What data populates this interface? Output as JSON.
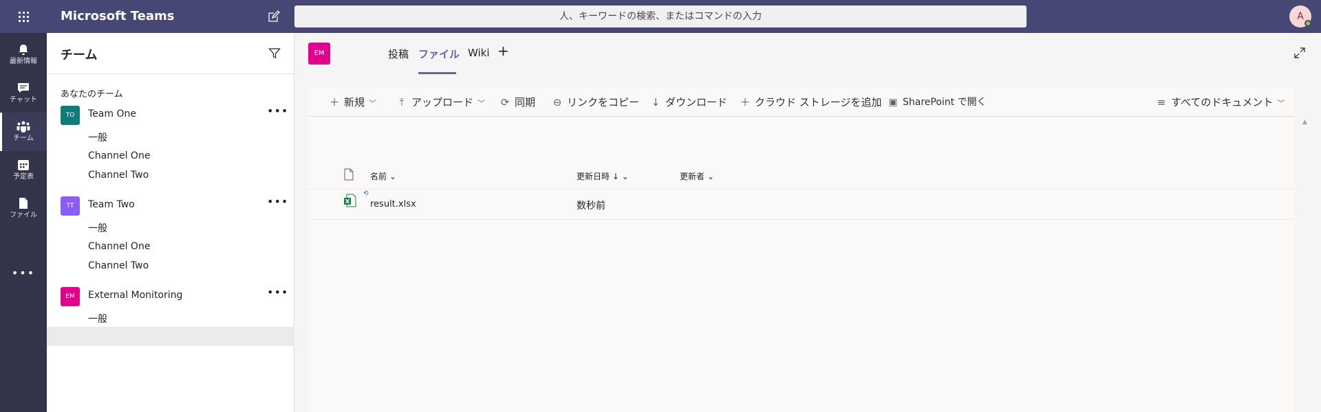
{
  "app": {
    "title": "Microsoft Teams",
    "search_placeholder": "人、キーワードの検索、またはコマンドの入力",
    "user_initial": "A",
    "accent": "#464775"
  },
  "rail": [
    {
      "label": "最新情報",
      "icon": "bell-icon",
      "active": false
    },
    {
      "label": "チャット",
      "icon": "chat-icon",
      "active": false
    },
    {
      "label": "チーム",
      "icon": "teams-icon",
      "active": true
    },
    {
      "label": "予定表",
      "icon": "calendar-icon",
      "active": false
    },
    {
      "label": "ファイル",
      "icon": "files-icon",
      "active": false
    }
  ],
  "rail_more": "•••",
  "teams_pane": {
    "title": "チーム",
    "section_label": "あなたのチーム",
    "teams": [
      {
        "initials": "TO",
        "name": "Team One",
        "color": "#0f7b7b",
        "channels": [
          "一般",
          "Channel One",
          "Channel Two"
        ]
      },
      {
        "initials": "TT",
        "name": "Team Two",
        "color": "#8b5cf6",
        "channels": [
          "一般",
          "Channel One",
          "Channel Two"
        ]
      },
      {
        "initials": "EM",
        "name": "External Monitoring",
        "color": "#e3008c",
        "channels": [
          "一般"
        ]
      }
    ],
    "more": "•••"
  },
  "main": {
    "team_initials": "EM",
    "tabs": [
      {
        "label": "投稿",
        "active": false
      },
      {
        "label": "ファイル",
        "active": true
      },
      {
        "label": "Wiki",
        "active": false
      }
    ],
    "tab_add": "+",
    "toolbar": {
      "new": "新規",
      "upload": "アップロード",
      "sync": "同期",
      "copy_link": "リンクをコピー",
      "download": "ダウンロード",
      "add_cloud": "クラウド ストレージを追加",
      "sharepoint": "SharePoint で開く",
      "view": "すべてのドキュメント"
    },
    "columns": {
      "name": "名前",
      "modified": "更新日時",
      "modified_by": "更新者"
    },
    "files": [
      {
        "name": "result.xlsx",
        "modified": "数秒前",
        "modified_by": ""
      }
    ]
  }
}
